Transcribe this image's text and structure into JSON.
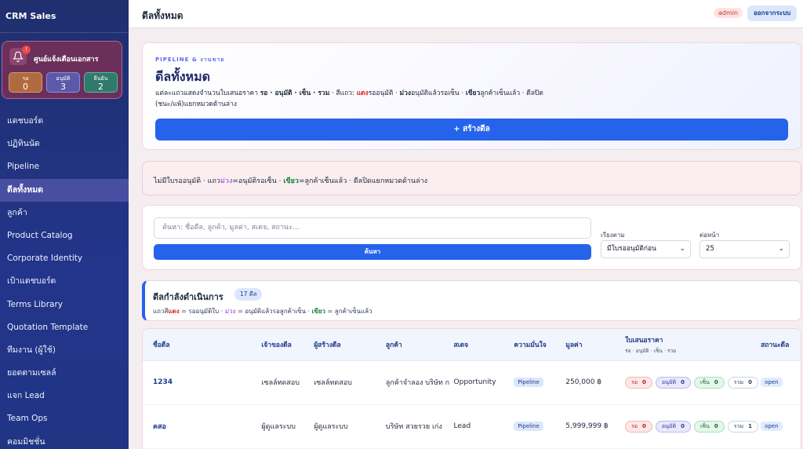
{
  "sidebar": {
    "brand": "CRM Sales",
    "notif": {
      "title": "ศูนย์แจ้งเตือนเอกสาร",
      "badge": "!",
      "stats": [
        {
          "label": "รอ",
          "value": "0"
        },
        {
          "label": "อนุมัติ",
          "value": "3"
        },
        {
          "label": "ยืนยัน",
          "value": "2"
        }
      ]
    },
    "items": [
      {
        "label": "แดชบอร์ด"
      },
      {
        "label": "ปฏิทินนัด"
      },
      {
        "label": "Pipeline"
      },
      {
        "label": "ดีลทั้งหมด"
      },
      {
        "label": "ลูกค้า"
      },
      {
        "label": "Product Catalog"
      },
      {
        "label": "Corporate Identity"
      },
      {
        "label": "เป้าแดชบอร์ด"
      },
      {
        "label": "Terms Library"
      },
      {
        "label": "Quotation Template"
      },
      {
        "label": "ทีมงาน (ผู้ใช้)"
      },
      {
        "label": "ยอดตามเซลล์"
      },
      {
        "label": "แจก Lead"
      },
      {
        "label": "Team Ops"
      },
      {
        "label": "คอมมิชชั่น"
      }
    ]
  },
  "topbar": {
    "title": "ดีลทั้งหมด",
    "role": "admin",
    "logout": "ออกจากระบบ"
  },
  "hero": {
    "kicker": "PIPELINE & งานขาย",
    "title": "ดีลทั้งหมด",
    "desc_a": "แต่ละแถวแสดงจำนวนใบเสนอราคา ",
    "desc_b": "รอ · อนุมัติ · เซ็น · รวม",
    "desc_c": " · สีแถว: ",
    "desc_d": "แดง",
    "desc_e": "รออนุมัติ · ",
    "desc_f": "ม่วง",
    "desc_g": "อนุมัติแล้วรอเซ็น · ",
    "desc_h": "เขียว",
    "desc_i": "ลูกค้าเซ็นแล้ว · ดีลปิด (ชนะ/แพ้)แยกหมวดด้านล่าง",
    "create": "+ สร้างดีล"
  },
  "notice": {
    "a": "ไม่มีใบรออนุมัติ · แถว",
    "b": "ม่วง",
    "c": "=อนุมัติรอเซ็น · ",
    "d": "เขียว",
    "e": "=ลูกค้าเซ็นแล้ว · ดีลปิดแยกหมวดด้านล่าง"
  },
  "search": {
    "placeholder": "ค้นหา: ชื่อดีล, ลูกค้า, มูลค่า, สเตจ, สถานะ...",
    "button": "ค้นหา",
    "sort_label": "เรียงตาม",
    "sort_value": "มีใบรออนุมัติก่อน",
    "per_page_label": "ต่อหน้า",
    "per_page_value": "25"
  },
  "progress": {
    "title": "ดีลกำลังดำเนินการ",
    "count": "17 ดีล",
    "leg_a": "แถวสี",
    "leg_b": "แดง",
    "leg_c": " = รออนุมัติใบ · ",
    "leg_d": "ม่วง",
    "leg_e": " = อนุมัติแล้วรอลูกค้าเซ็น · ",
    "leg_f": "เขียว",
    "leg_g": " = ลูกค้าเซ็นแล้ว"
  },
  "table": {
    "headers": {
      "name": "ชื่อดีล",
      "owner": "เจ้าของดีล",
      "creator": "ผู้สร้างดีล",
      "customer": "ลูกค้า",
      "stage": "สเตจ",
      "confidence": "ความมั่นใจ",
      "value": "มูลค่า",
      "quote": "ใบเสนอราคา",
      "quote_sub": "รอ · อนุมัติ · เซ็น · รวม",
      "status": "สถานะดีล"
    },
    "quote_labels": {
      "wait": "รอ",
      "approved": "อนุมัติ",
      "signed": "เซ็น",
      "total": "รวม"
    },
    "rows": [
      {
        "name": "1234",
        "owner": "เซลล์ทดสอบ",
        "creator": "เซลล์ทดสอบ",
        "customer": "ลูกค้าจำลอง บริษัท ก",
        "stage": "Opportunity",
        "confidence": "Pipeline",
        "value": "250,000 ฿",
        "wait": "0",
        "approved": "0",
        "signed": "0",
        "total": "0",
        "status": "open"
      },
      {
        "name": "คสอ",
        "owner": "ผู้ดูแลระบบ",
        "creator": "ผู้ดูแลระบบ",
        "customer": "บริษัท สวยรวย เก่ง",
        "stage": "Lead",
        "confidence": "Pipeline",
        "value": "5,999,999 ฿",
        "wait": "0",
        "approved": "0",
        "signed": "0",
        "total": "1",
        "status": "open"
      }
    ]
  }
}
